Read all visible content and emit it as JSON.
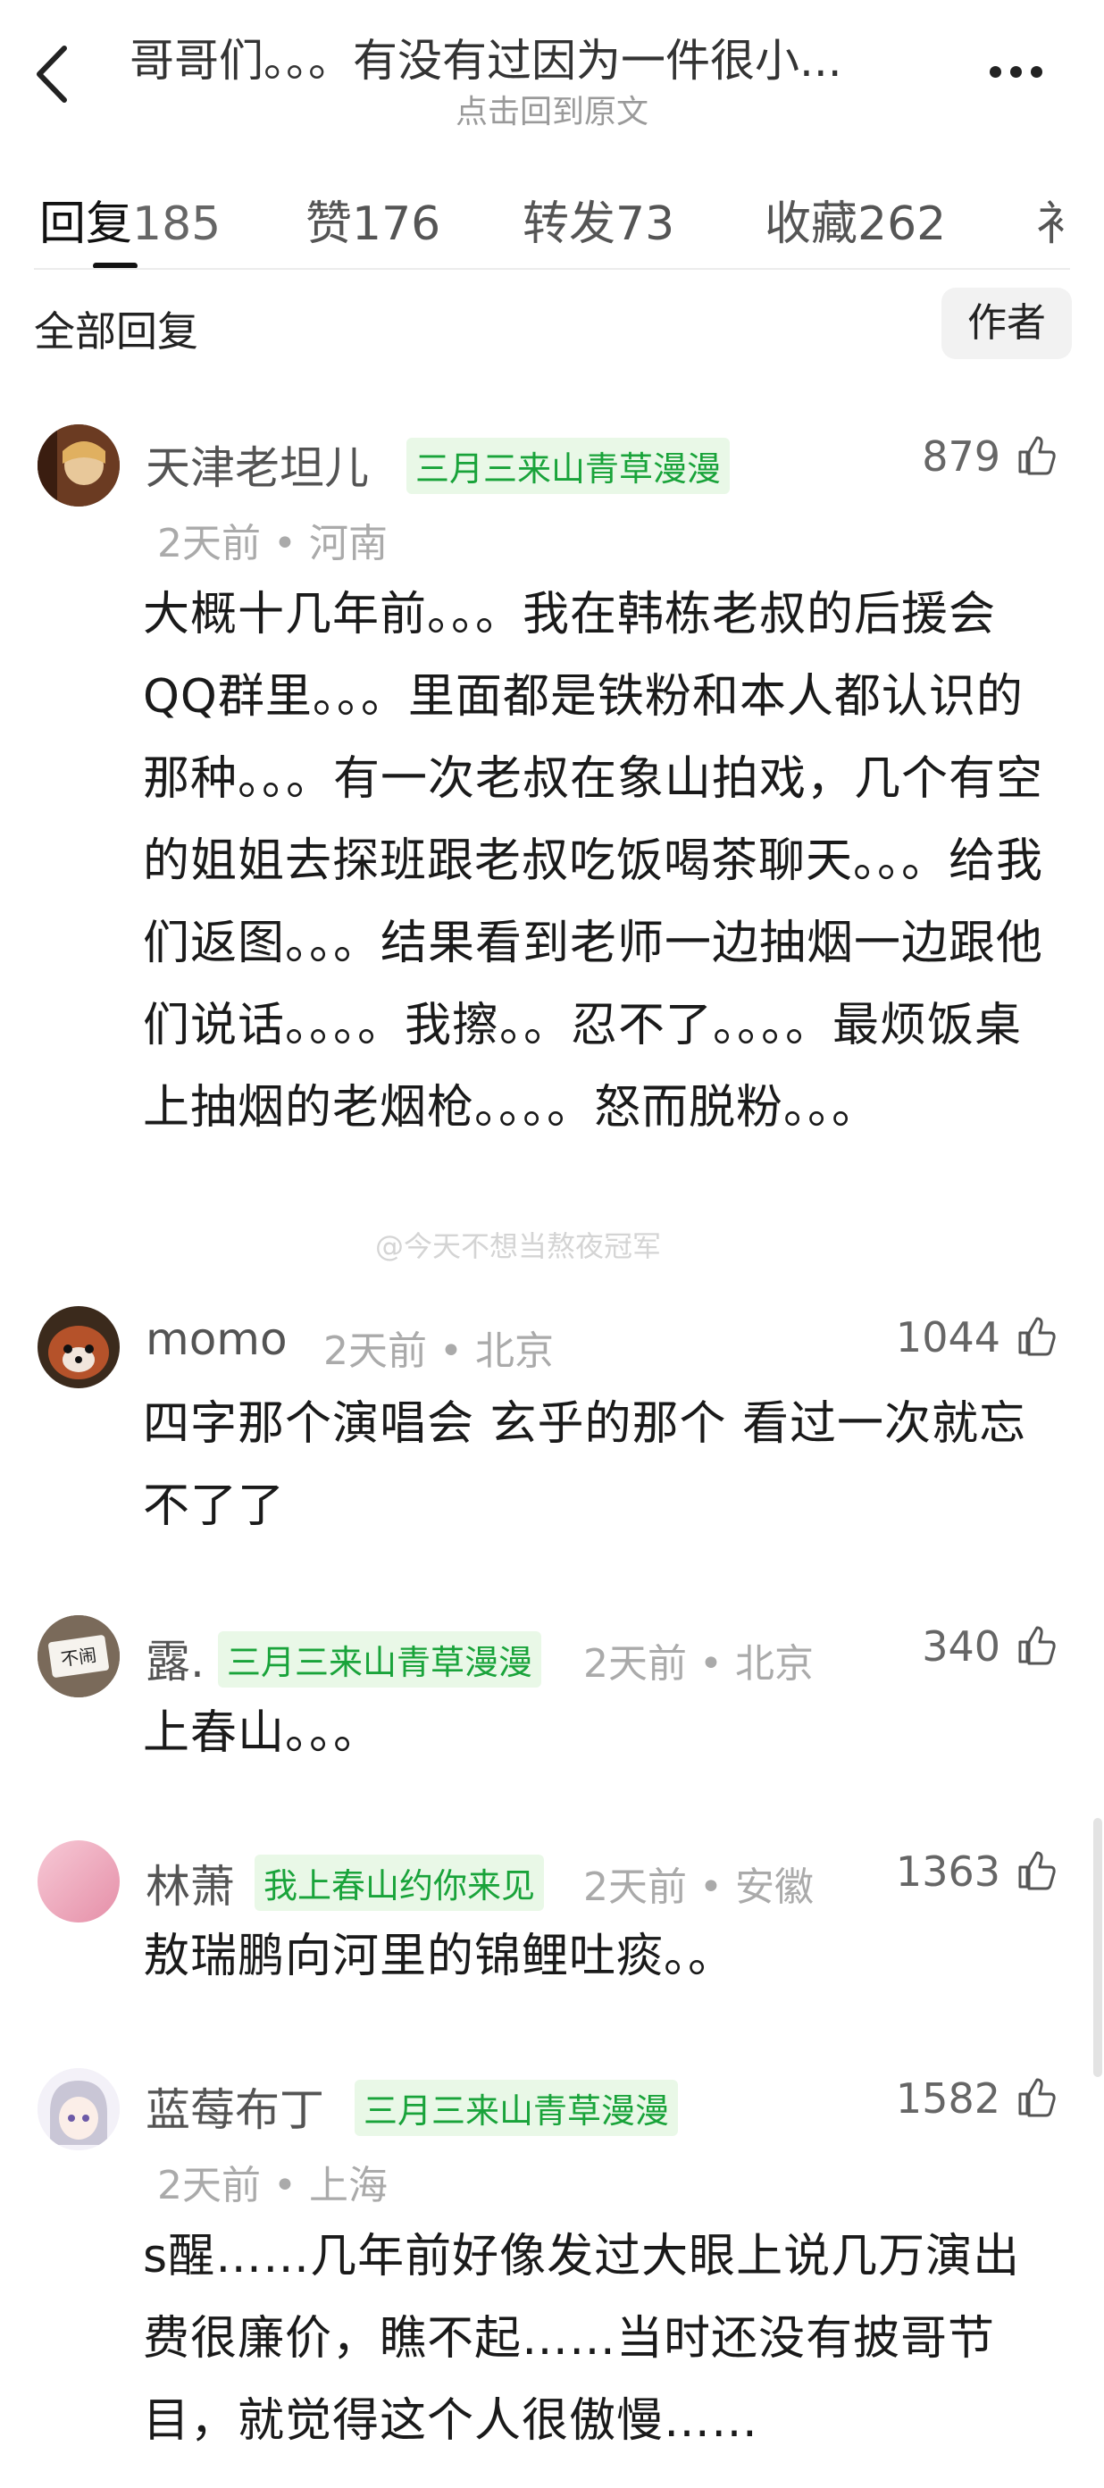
{
  "header": {
    "title": "哥哥们。。。有没有过因为一件很小...",
    "subtitle": "点击回到原文"
  },
  "tabs": [
    {
      "label": "回复",
      "count": "185"
    },
    {
      "label": "赞",
      "count": "176"
    },
    {
      "label": "转发",
      "count": "73"
    },
    {
      "label": "收藏",
      "count": "262"
    },
    {
      "label": "衤",
      "count": ""
    }
  ],
  "filter": {
    "all_label": "全部回复",
    "author_label": "作者"
  },
  "comments": [
    {
      "user": "天津老坦儿",
      "badge": "三月三来山青草漫漫",
      "time": "2天前",
      "sep": "•",
      "location": "河南",
      "likes": "879",
      "text": "大概十几年前。。。我在韩栋老叔的后援会QQ群里。。。里面都是铁粉和本人都认识的那种。。。有一次老叔在象山拍戏，几个有空的姐姐去探班跟老叔吃饭喝茶聊天。。。给我们返图。。。结果看到老师一边抽烟一边跟他们说话。。。。我擦。。忍不了。。。。最烦饭桌上抽烟的老烟枪。。。。怒而脱粉。。。"
    },
    {
      "user": "momo",
      "badge": "",
      "time": "2天前",
      "sep": "•",
      "location": "北京",
      "likes": "1044",
      "text": "四字那个演唱会 玄乎的那个 看过一次就忘不了了"
    },
    {
      "user": "露.",
      "badge": "三月三来山青草漫漫",
      "time": "2天前",
      "sep": "•",
      "location": "北京",
      "likes": "340",
      "text": "上春山。。。"
    },
    {
      "user": "林萧",
      "badge": "我上春山约你来见",
      "time": "2天前",
      "sep": "•",
      "location": "安徽",
      "likes": "1363",
      "text": "敖瑞鹏向河里的锦鲤吐痰。。"
    },
    {
      "user": "蓝莓布丁",
      "badge": "三月三来山青草漫漫",
      "time": "2天前",
      "sep": "•",
      "location": "上海",
      "likes": "1582",
      "text": "s醒……几年前好像发过大眼上说几万演出费很廉价，瞧不起……当时还没有披哥节目，就觉得这个人很傲慢……"
    }
  ],
  "avatar3_text": "不闹",
  "watermark": "@今天不想当熬夜冠军",
  "colors": {
    "badge_bg": "#e9f8e7",
    "badge_text": "#19a33a",
    "meta": "#aaaaaa"
  }
}
